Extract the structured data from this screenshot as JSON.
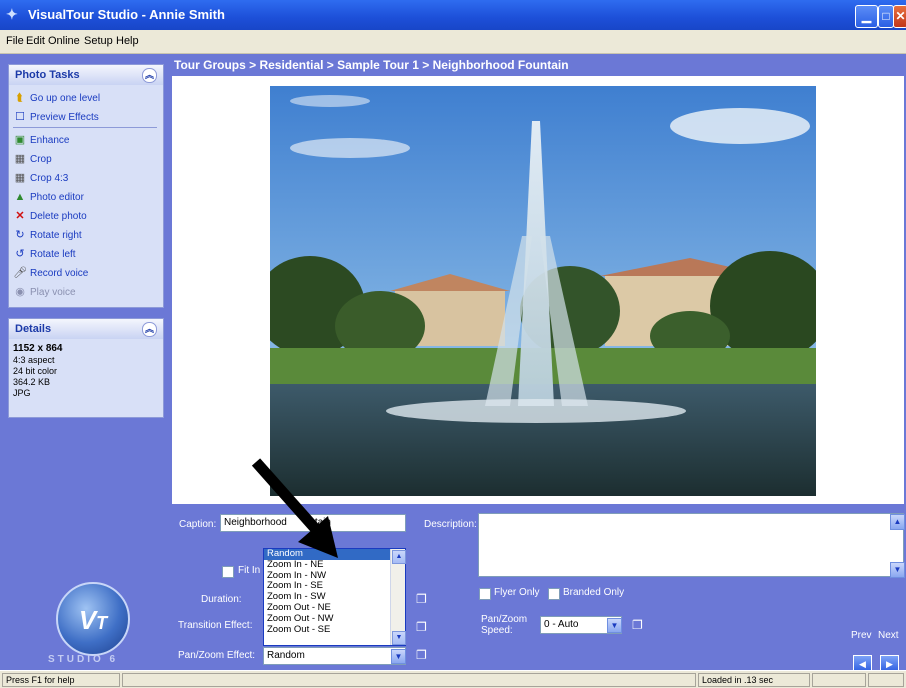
{
  "window": {
    "title": "VisualTour Studio - Annie Smith"
  },
  "menu": [
    "File",
    "Edit",
    "Online",
    "Setup",
    "Help"
  ],
  "photo_tasks": {
    "title": "Photo Tasks",
    "items": [
      {
        "label": "Go up one level",
        "icon": "folder-up-icon",
        "enabled": true
      },
      {
        "label": "Preview Effects",
        "icon": "checkbox-icon",
        "enabled": true
      },
      {
        "label": "Enhance",
        "icon": "enhance-icon",
        "enabled": true
      },
      {
        "label": "Crop",
        "icon": "crop-icon",
        "enabled": true
      },
      {
        "label": "Crop 4:3",
        "icon": "crop-icon",
        "enabled": true
      },
      {
        "label": "Photo editor",
        "icon": "photo-editor-icon",
        "enabled": true
      },
      {
        "label": "Delete photo",
        "icon": "delete-icon",
        "enabled": true
      },
      {
        "label": "Rotate right",
        "icon": "rotate-right-icon",
        "enabled": true
      },
      {
        "label": "Rotate left",
        "icon": "rotate-left-icon",
        "enabled": true
      },
      {
        "label": "Record voice",
        "icon": "microphone-icon",
        "enabled": true
      },
      {
        "label": "Play voice",
        "icon": "speaker-icon",
        "enabled": false
      }
    ]
  },
  "details": {
    "title": "Details",
    "dimensions": "1152 x 864",
    "aspect": "4:3 aspect",
    "color": "24 bit color",
    "size": "364.2 KB",
    "format": "JPG"
  },
  "breadcrumb": "Tour Groups > Residential > Sample Tour 1 > Neighborhood Fountain",
  "controls": {
    "caption_label": "Caption:",
    "caption_visible_left": "Neighborhood",
    "caption_visible_right": "tain",
    "description_label": "Description:",
    "description_value": "",
    "fit_in_label": "Fit In",
    "duration_label": "Duration:",
    "transition_label": "Transition Effect:",
    "panzoom_label": "Pan/Zoom Effect:",
    "panzoom_value": "Random",
    "flyer_only": "Flyer Only",
    "branded_only": "Branded Only",
    "panzoom_speed_label_1": "Pan/Zoom",
    "panzoom_speed_label_2": "Speed:",
    "panzoom_speed_value": "0 - Auto",
    "prev_label": "Prev",
    "next_label": "Next"
  },
  "dropdown_options": [
    "Random",
    "Zoom In - NE",
    "Zoom In - NW",
    "Zoom In - SE",
    "Zoom In - SW",
    "Zoom Out - NE",
    "Zoom Out - NW",
    "Zoom Out - SE"
  ],
  "dropdown_selected_index": 0,
  "logo": {
    "text": "STUDIO 6"
  },
  "status": {
    "help": "Press F1 for help",
    "loaded": "Loaded in .13 sec"
  },
  "colors": {
    "accent": "#6b78d6",
    "title_bar": "#1d4fd8",
    "selection": "#316ac5"
  }
}
